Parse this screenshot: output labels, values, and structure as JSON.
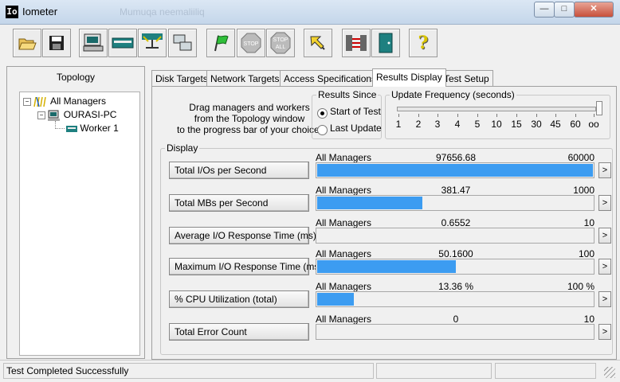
{
  "window": {
    "title": "Iometer",
    "icon_text": "Io",
    "background_blur_text": "Mumuqa neemaliiliq"
  },
  "toolbar": {
    "buttons": [
      {
        "name": "open-config-button",
        "icon": "folder-open-icon"
      },
      {
        "name": "save-config-button",
        "icon": "floppy-disk-icon"
      },
      {
        "name": "new-disk-worker-button",
        "icon": "disk-worker-icon"
      },
      {
        "name": "new-network-worker-button",
        "icon": "network-worker-icon"
      },
      {
        "name": "duplicate-worker-button",
        "icon": "duplicate-worker-icon"
      },
      {
        "name": "disconnect-button",
        "icon": "disconnect-icon"
      },
      {
        "name": "start-button",
        "icon": "green-flag-icon"
      },
      {
        "name": "stop-button",
        "icon": "stop-sign-icon"
      },
      {
        "name": "stop-all-button",
        "icon": "stop-all-icon"
      },
      {
        "name": "reset-workers-button",
        "icon": "reset-arrow-icon"
      },
      {
        "name": "exit-button",
        "icon": "exit-door-icon"
      },
      {
        "name": "help-button",
        "icon": "question-icon"
      }
    ],
    "stop_label": "STOP",
    "stop_all_label1": "STOP",
    "stop_all_label2": "ALL",
    "help_label": "?"
  },
  "topology": {
    "header": "Topology",
    "tree": {
      "all_managers": "All Managers",
      "manager": "OURASI-PC",
      "worker": "Worker 1"
    }
  },
  "tabs": [
    {
      "label": "Disk Targets"
    },
    {
      "label": "Network Targets"
    },
    {
      "label": "Access Specifications"
    },
    {
      "label": "Results Display"
    },
    {
      "label": "Test Setup"
    }
  ],
  "results": {
    "instructions": [
      "Drag managers and workers",
      "from the Topology window",
      "to the progress bar of your choice."
    ],
    "since": {
      "title": "Results Since",
      "option1": "Start of Test",
      "option2": "Last Update",
      "selected": "Start of Test"
    },
    "update": {
      "title": "Update Frequency (seconds)",
      "ticks": [
        "1",
        "2",
        "3",
        "4",
        "5",
        "10",
        "15",
        "30",
        "45",
        "60",
        "oo"
      ],
      "slider_position": "oo"
    },
    "display_title": "Display",
    "metrics": [
      {
        "label": "Total I/Os per Second",
        "source": "All Managers",
        "value": "97656.68",
        "max": "60000",
        "fill": 1.0
      },
      {
        "label": "Total MBs per Second",
        "source": "All Managers",
        "value": "381.47",
        "max": "1000",
        "fill": 0.3815
      },
      {
        "label": "Average I/O Response Time (ms)",
        "source": "All Managers",
        "value": "0.6552",
        "max": "10",
        "fill": 0.0
      },
      {
        "label": "Maximum I/O Response Time (ms)",
        "source": "All Managers",
        "value": "50.1600",
        "max": "100",
        "fill": 0.5016
      },
      {
        "label": "% CPU Utilization (total)",
        "source": "All Managers",
        "value": "13.36 %",
        "max": "100 %",
        "fill": 0.1336
      },
      {
        "label": "Total Error Count",
        "source": "All Managers",
        "value": "0",
        "max": "10",
        "fill": 0.0
      }
    ],
    "arrow_label": ">"
  },
  "status": {
    "text": "Test Completed Successfully"
  },
  "colors": {
    "bar_fill": "#3c9cf1"
  }
}
